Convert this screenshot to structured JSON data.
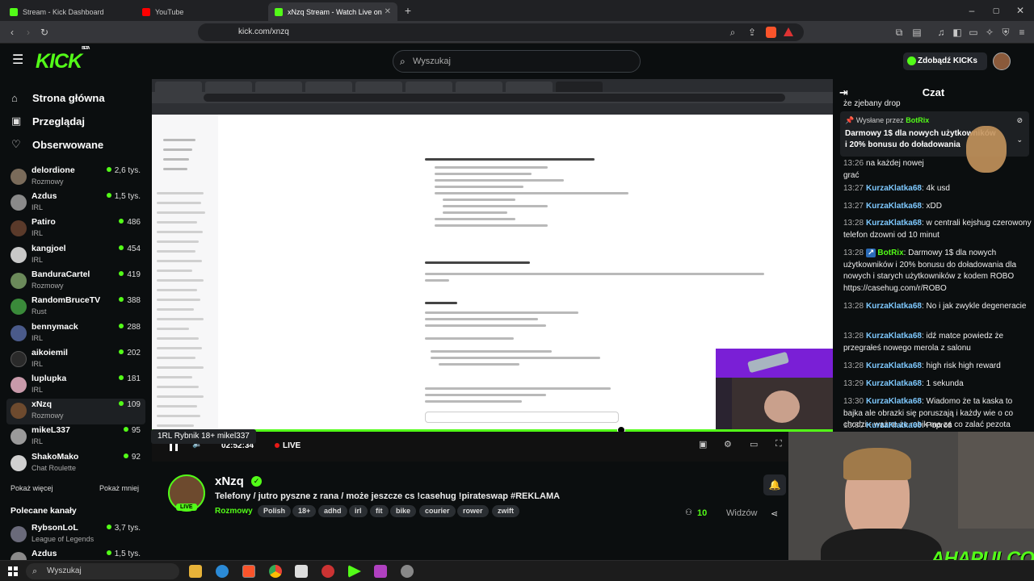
{
  "browser": {
    "tabs": [
      {
        "label": "Stream - Kick Dashboard",
        "color": "#53fc18"
      },
      {
        "label": "YouTube",
        "color": "#ff0000"
      },
      {
        "label": "xNzq Stream - Watch Live on",
        "color": "#53fc18"
      }
    ],
    "url": "kick.com/xnzq"
  },
  "header": {
    "logo": "KICK",
    "logo_sup": "BETA",
    "search_placeholder": "Wyszukaj",
    "kicks_button": "Zdobądź KICKs"
  },
  "sidebar": {
    "nav": [
      "Strona główna",
      "Przeglądaj",
      "Obserwowane"
    ],
    "channels": [
      {
        "name": "delordione",
        "category": "Rozmowy",
        "viewers": "2,6 tys.",
        "color": "#7a6b5a"
      },
      {
        "name": "Azdus",
        "category": "IRL",
        "viewers": "1,5 tys.",
        "color": "#8a8a8a"
      },
      {
        "name": "Patiro",
        "category": "IRL",
        "viewers": "486",
        "color": "#5a3a2a"
      },
      {
        "name": "kangjoel",
        "category": "IRL",
        "viewers": "454",
        "color": "#c8c8c8"
      },
      {
        "name": "BanduraCartel",
        "category": "Rozmowy",
        "viewers": "419",
        "color": "#6b8a5a"
      },
      {
        "name": "RandomBruceTV",
        "category": "Rust",
        "viewers": "388",
        "color": "#3a8a3a"
      },
      {
        "name": "bennymack",
        "category": "IRL",
        "viewers": "288",
        "color": "#4a5a8a"
      },
      {
        "name": "aikoiemil",
        "category": "IRL",
        "viewers": "202",
        "color": "#2a2a2a"
      },
      {
        "name": "luplupka",
        "category": "IRL",
        "viewers": "181",
        "color": "#c89aaa"
      },
      {
        "name": "xNzq",
        "category": "Rozmowy",
        "viewers": "109",
        "color": "#6d4a2e"
      },
      {
        "name": "mikeL337",
        "category": "IRL",
        "viewers": "95",
        "color": "#9a9a9a"
      },
      {
        "name": "ShakoMako",
        "category": "Chat Roulette",
        "viewers": "92",
        "color": "#d0d0d0"
      }
    ],
    "show_more": "Pokaż więcej",
    "show_less": "Pokaż mniej",
    "recommended_title": "Polecane kanały",
    "recommended": [
      {
        "name": "RybsonLoL",
        "category": "League of Legends",
        "viewers": "3,7 tys.",
        "color": "#6a6a7a"
      },
      {
        "name": "Azdus",
        "category": "",
        "viewers": "1,5 tys.",
        "color": "#8a8a8a"
      }
    ],
    "tooltip": "1RL Rybnik 18+ mikel337"
  },
  "video": {
    "live_label": "LIVE",
    "time": "02:52:34"
  },
  "stream": {
    "name": "xNzq",
    "live": "LIVE",
    "title": "Telefony / jutro pyszne z rana / może jeszcze cs !casehug !pirateswap #REKLAMA",
    "category": "Rozmowy",
    "tags": [
      "Polish",
      "18+",
      "adhd",
      "irl",
      "fit",
      "bike",
      "courier",
      "rower",
      "zwift"
    ],
    "viewers": "10",
    "viewers_label": "Widzów"
  },
  "chat": {
    "title": "Czat",
    "top_fragment": "że zjebany drop",
    "pinned_label": "Wysłane przez",
    "pinned_user": "BotRix",
    "pinned_text": "Darmowy 1$ dla nowych użytkowników i 20% bonusu do doładowania",
    "fragment_time": "13:26",
    "fragment_text": "na każdej nowej",
    "fragment_text2": "grać",
    "messages": [
      {
        "time": "13:27",
        "user": "KurzaKlatka68",
        "text": "4k usd"
      },
      {
        "time": "13:27",
        "user": "KurzaKlatka68",
        "text": "xDD"
      },
      {
        "time": "13:28",
        "user": "KurzaKlatka68",
        "text": "w centrali kejshug czerowony telefon dzowni od 10 minut"
      },
      {
        "time": "13:28",
        "user": "BotRix",
        "text": "Darmowy 1$ dla nowych użytkowników i 20% bonusu do doładowania dla nowych i starych użytkowników z kodem ROBO https://casehug.com/r/ROBO"
      },
      {
        "time": "13:28",
        "user": "KurzaKlatka68",
        "text": "No i jak zwykle degeneracie"
      },
      {
        "time": "13:28",
        "user": "KurzaKlatka68",
        "text": "idź matce powiedz że przegrałeś nowego merola z salonu"
      },
      {
        "time": "13:28",
        "user": "KurzaKlatka68",
        "text": "high risk high reward"
      },
      {
        "time": "13:29",
        "user": "KurzaKlatka68",
        "text": "1 sekunda"
      },
      {
        "time": "13:30",
        "user": "KurzaKlatka68",
        "text": "Wiadomo że ta kaska to bajka ale obrazki się poruszają i każdy wie o co chodzi - ważne że robik ma za co zalać pezota"
      },
      {
        "time": "13:30",
        "user": "KurzaKlatka68",
        "text": "Poproś czata lpg żeby ci"
      }
    ],
    "webcam_overlay": "AHAPULCO"
  },
  "taskbar": {
    "search": "Wyszukaj"
  }
}
